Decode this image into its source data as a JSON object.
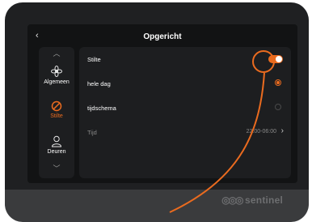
{
  "screen": {
    "title": "Opgericht",
    "back_label": "‹"
  },
  "nav": {
    "items": [
      {
        "label": "Algemeen",
        "icon": "gear-flower-icon",
        "active": false
      },
      {
        "label": "Stilte",
        "icon": "no-sign-icon",
        "active": true
      },
      {
        "label": "Deuren",
        "icon": "user-icon",
        "active": false
      }
    ]
  },
  "settings": {
    "rows": [
      {
        "label": "Stilte",
        "control": "toggle",
        "state": "on"
      },
      {
        "label": "hele dag",
        "control": "radio",
        "selected": true
      },
      {
        "label": "tijdschema",
        "control": "radio",
        "selected": false
      },
      {
        "label": "Tijd",
        "value": "22:00-06:00",
        "control": "chevron"
      }
    ]
  },
  "brand": {
    "text": "sentinel"
  },
  "colors": {
    "accent": "#ea6b1f",
    "screen_bg": "#121314",
    "panel_bg": "#1d1e20",
    "device_bg": "#1f2022"
  }
}
